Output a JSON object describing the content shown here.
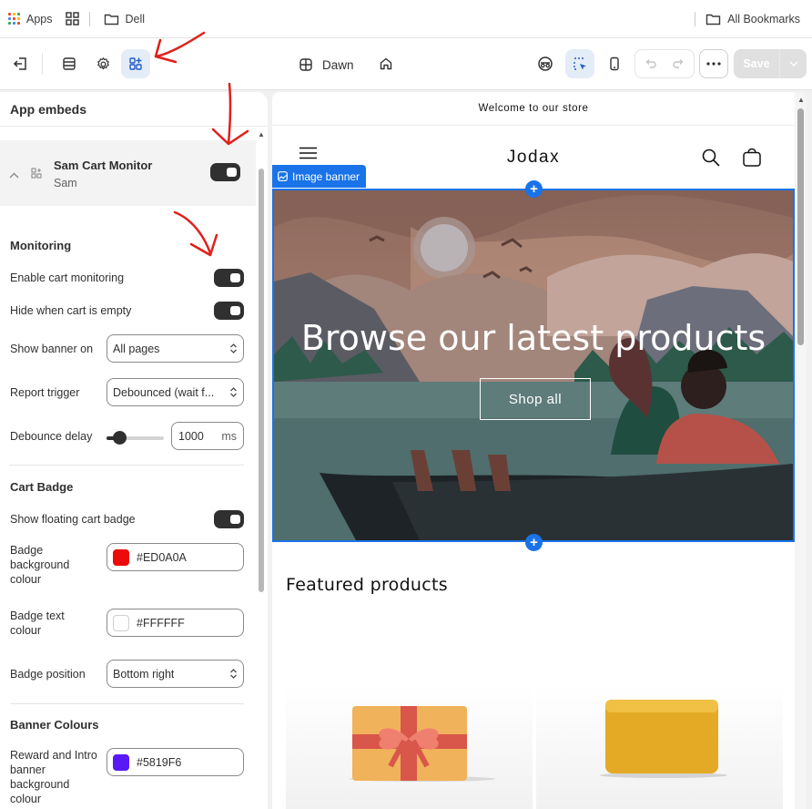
{
  "bookmarks_bar": {
    "apps_label": "Apps",
    "folder_label": "Dell",
    "all_bookmarks_label": "All Bookmarks"
  },
  "toolbar": {
    "theme_name": "Dawn",
    "save_label": "Save"
  },
  "panel": {
    "header": "App embeds",
    "embed": {
      "title": "Sam Cart Monitor",
      "subtitle": "Sam",
      "enabled": true
    },
    "monitoring": {
      "title": "Monitoring",
      "enable_cart_monitoring_label": "Enable cart monitoring",
      "hide_when_empty_label": "Hide when cart is empty",
      "show_banner_on_label": "Show banner on",
      "show_banner_on_value": "All pages",
      "report_trigger_label": "Report trigger",
      "report_trigger_value": "Debounced (wait f...",
      "debounce_delay_label": "Debounce delay",
      "debounce_delay_value": "1000",
      "debounce_delay_unit": "ms"
    },
    "cart_badge": {
      "title": "Cart Badge",
      "show_floating_label": "Show floating cart badge",
      "badge_bg_label": "Badge background colour",
      "badge_bg_value": "#ED0A0A",
      "badge_text_label": "Badge text colour",
      "badge_text_value": "#FFFFFF",
      "badge_position_label": "Badge position",
      "badge_position_value": "Bottom right"
    },
    "banner_colours": {
      "title": "Banner Colours",
      "reward_bg_label": "Reward and Intro banner background colour",
      "reward_bg_value": "#5819F6"
    }
  },
  "preview": {
    "announcement": "Welcome to our store",
    "store_name": "Jodax",
    "section_tag": "Image banner",
    "banner_heading": "Browse our latest products",
    "banner_button": "Shop all",
    "featured_heading": "Featured products"
  },
  "colors": {
    "accent": "#1a73e8",
    "annotation_arrow": "#e0201a",
    "badge_bg_swatch": "#ED0A0A",
    "badge_text_swatch": "#FFFFFF",
    "reward_bg_swatch": "#5819F6"
  }
}
